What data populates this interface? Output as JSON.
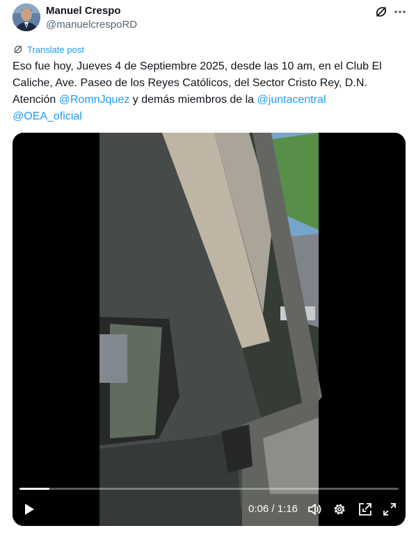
{
  "author": {
    "name": "Manuel Crespo",
    "handle": "@manuelcrespoRD"
  },
  "actions": {
    "grok_icon": "grok-icon",
    "more_icon": "more-options-icon"
  },
  "translate_label": "Translate post",
  "post": {
    "text_1": "Eso fue hoy, Jueves 4 de Septiembre 2025, desde las 10 am, en el Club El Caliche, Ave. Paseo de los Reyes Católicos, del Sector Cristo Rey, D.N. Atención ",
    "mention_1": "@RomnJquez",
    "text_2": " y demás miembros de la ",
    "mention_2": "@juntacentral",
    "mention_3": "@OEA_oficial"
  },
  "video": {
    "current_time": "0:06",
    "separator": " / ",
    "duration": "1:16",
    "progress_fraction": 0.079
  },
  "colors": {
    "link": "#1d9bf0",
    "text": "#0f1419",
    "secondary": "#536471"
  }
}
